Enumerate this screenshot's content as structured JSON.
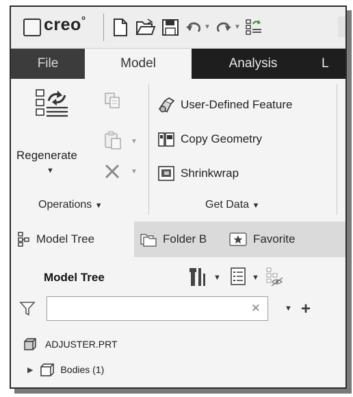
{
  "app": {
    "brand": "creo",
    "brand_mark": "°"
  },
  "quick_access": {
    "icons": [
      "new-file-icon",
      "open-file-icon",
      "save-icon",
      "undo-icon",
      "redo-icon",
      "regenerate-small-icon"
    ]
  },
  "tabs": [
    {
      "label": "File"
    },
    {
      "label": "Model",
      "active": true
    },
    {
      "label": "Analysis"
    },
    {
      "label": "L"
    }
  ],
  "ribbon": {
    "regenerate_label": "Regenerate",
    "operations_label": "Operations",
    "get_data": {
      "commands": [
        "User-Defined Feature",
        "Copy Geometry",
        "Shrinkwrap"
      ],
      "label": "Get Data"
    }
  },
  "panel_tabs": [
    {
      "label": "Model Tree",
      "active": true
    },
    {
      "label": "Folder B"
    },
    {
      "label": "Favorite"
    }
  ],
  "model_tree": {
    "title": "Model Tree",
    "search_value": "",
    "search_placeholder": "",
    "items": [
      {
        "label": "ADJUSTER.PRT",
        "expandable": false
      },
      {
        "label": "Bodies (1)",
        "expandable": true
      }
    ]
  },
  "colors": {
    "tab_bar": "#1e1e1e",
    "file_tab": "#3c3c3c",
    "ribbon_bg": "#f4f4f4",
    "accent_green": "#3a8a2c"
  }
}
